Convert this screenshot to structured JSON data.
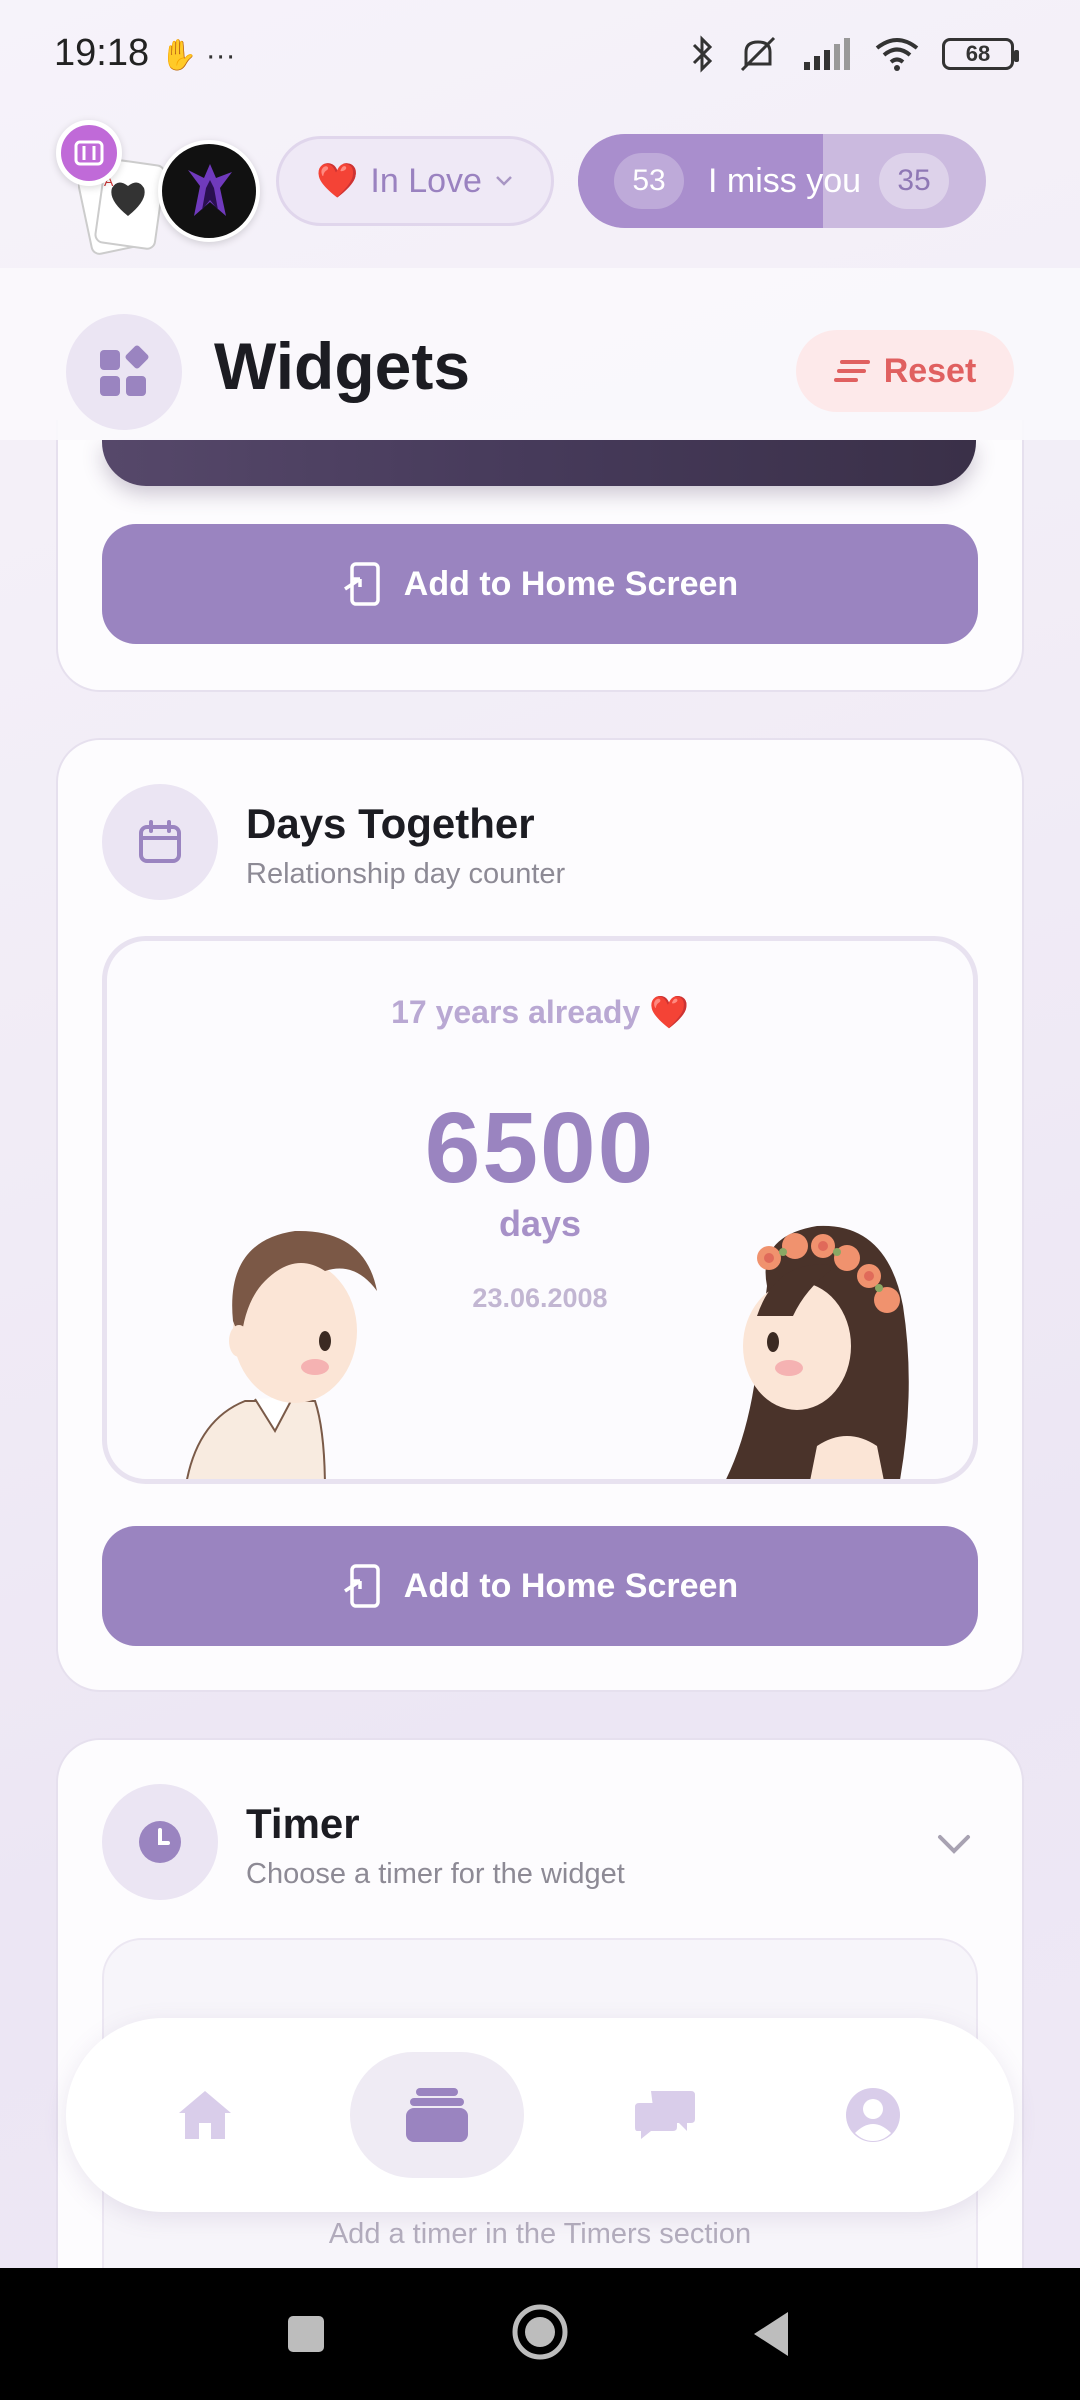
{
  "status_bar": {
    "time": "19:18",
    "left_icons": "✋ ···",
    "battery": "68"
  },
  "profile": {
    "mood_emoji": "❤️",
    "mood_label": "In Love",
    "miss_count_left": "53",
    "miss_label": "I miss you",
    "miss_count_right": "35",
    "miss_progress_fraction": 0.6
  },
  "header": {
    "title": "Widgets",
    "reset_label": "Reset"
  },
  "prev_card": {
    "add_button_label": "Add to Home Screen"
  },
  "days_card": {
    "title": "Days Together",
    "subtitle": "Relationship day counter",
    "years_text": "17 years already ❤️",
    "days_number": "6500",
    "days_unit": "days",
    "start_date": "23.06.2008",
    "add_button_label": "Add to Home Screen"
  },
  "timer_card": {
    "title": "Timer",
    "subtitle": "Choose a timer for the widget",
    "hint": "Add a timer in the Timers section"
  },
  "colors": {
    "accent": "#9a84c0",
    "reset": "#e06060",
    "card_bg": "#fdfcfe"
  },
  "icons": {
    "header": "widgets-icon",
    "days": "calendar-icon",
    "timer": "clock-icon",
    "nav": [
      "home-icon",
      "widgets-stack-icon",
      "chat-icon",
      "profile-icon"
    ]
  }
}
